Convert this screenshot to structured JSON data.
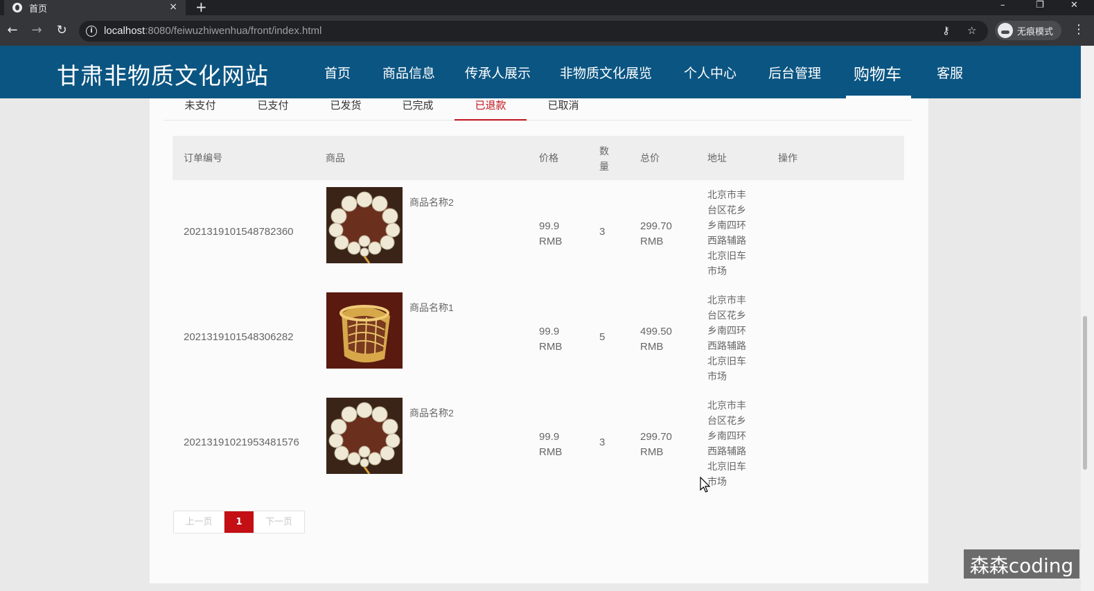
{
  "browser": {
    "tab_title": "首页",
    "tab_close": "×",
    "new_tab": "+",
    "url_host": "localhost",
    "url_rest": ":8080/feiwuzhiwenhua/front/index.html",
    "incognito_label": "无痕模式",
    "window_controls": {
      "minimize": "–",
      "restore": "❐",
      "close": "✕"
    },
    "nav": {
      "back": "←",
      "forward": "→",
      "reload": "↻",
      "info": "i",
      "key": "⚷",
      "star": "☆",
      "menu": "⋮"
    }
  },
  "site": {
    "title": "甘肃非物质文化网站",
    "nav": [
      {
        "label": "首页"
      },
      {
        "label": "商品信息"
      },
      {
        "label": "传承人展示"
      },
      {
        "label": "非物质文化展览"
      },
      {
        "label": "个人中心"
      },
      {
        "label": "后台管理"
      },
      {
        "label": "购物车",
        "active": true
      },
      {
        "label": "客服"
      }
    ]
  },
  "order_tabs": [
    {
      "label": "未支付"
    },
    {
      "label": "已支付"
    },
    {
      "label": "已发货"
    },
    {
      "label": "已完成"
    },
    {
      "label": "已退款",
      "active": true
    },
    {
      "label": "已取消"
    }
  ],
  "table": {
    "headers": {
      "order_no": "订单编号",
      "goods": "商品",
      "price": "价格",
      "qty": "数量",
      "total": "总价",
      "address": "地址",
      "action": "操作"
    },
    "rows": [
      {
        "order_no": "2021319101548782360",
        "goods_name": "商品名称2",
        "image": "bead-bracelet",
        "price": "99.9",
        "price_unit": "RMB",
        "qty": "3",
        "total": "299.70",
        "total_unit": "RMB",
        "address": "北京市丰台区花乡乡南四环西路辅路北京旧车市场"
      },
      {
        "order_no": "2021319101548306282",
        "goods_name": "商品名称1",
        "image": "woven-basket",
        "price": "99.9",
        "price_unit": "RMB",
        "qty": "5",
        "total": "499.50",
        "total_unit": "RMB",
        "address": "北京市丰台区花乡乡南四环西路辅路北京旧车市场"
      },
      {
        "order_no": "2021319102195348157​6",
        "goods_name": "商品名称2",
        "image": "bead-bracelet",
        "price": "99.9",
        "price_unit": "RMB",
        "qty": "3",
        "total": "299.70",
        "total_unit": "RMB",
        "address": "北京市丰台区花乡乡南四环西路辅路北京旧车市场"
      }
    ]
  },
  "pager": {
    "prev": "上一页",
    "current": "1",
    "next": "下一页"
  },
  "watermark": "森森coding",
  "colors": {
    "header_bg": "#0b5582",
    "accent_red": "#c0131d",
    "page_bg": "#e9e9e9"
  }
}
